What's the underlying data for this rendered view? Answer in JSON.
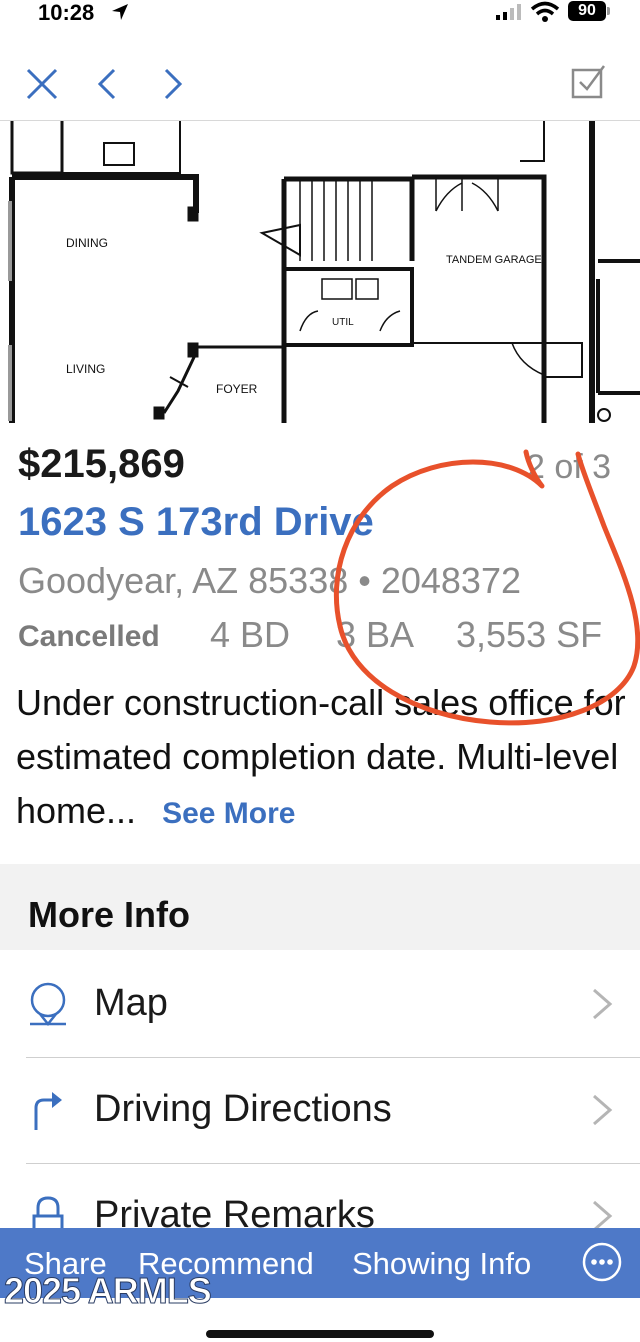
{
  "status_bar": {
    "time": "10:28",
    "battery": "90"
  },
  "floor_plan": {
    "rooms": [
      "DINING",
      "LIVING",
      "FOYER",
      "UTIL",
      "TANDEM GARAGE"
    ]
  },
  "listing": {
    "price": "$215,869",
    "photo_counter": "2 of 3",
    "address": "1623 S 173rd Drive",
    "city_line": "Goodyear, AZ 85338 • 2048372",
    "status": "Cancelled",
    "beds": "4 BD",
    "baths": "3 BA",
    "sqft": "3,553 SF",
    "description": "Under construction-call sales office for estimated completion date. Multi-level home...",
    "see_more": "See More"
  },
  "more_info": {
    "heading": "More Info",
    "items": [
      {
        "label": "Map",
        "icon": "map-pin-icon"
      },
      {
        "label": "Driving Directions",
        "icon": "turn-right-arrow-icon"
      },
      {
        "label": "Private Remarks",
        "icon": "lock-icon"
      }
    ]
  },
  "bottom_bar": {
    "tabs": [
      "Share",
      "Recommend",
      "Showing Info"
    ],
    "more_icon": "ellipsis-circle-icon",
    "color": "#4e79c8"
  },
  "watermark": "2025 ARMLS",
  "colors": {
    "link": "#3b6fbf",
    "annotation": "#e8512b"
  }
}
